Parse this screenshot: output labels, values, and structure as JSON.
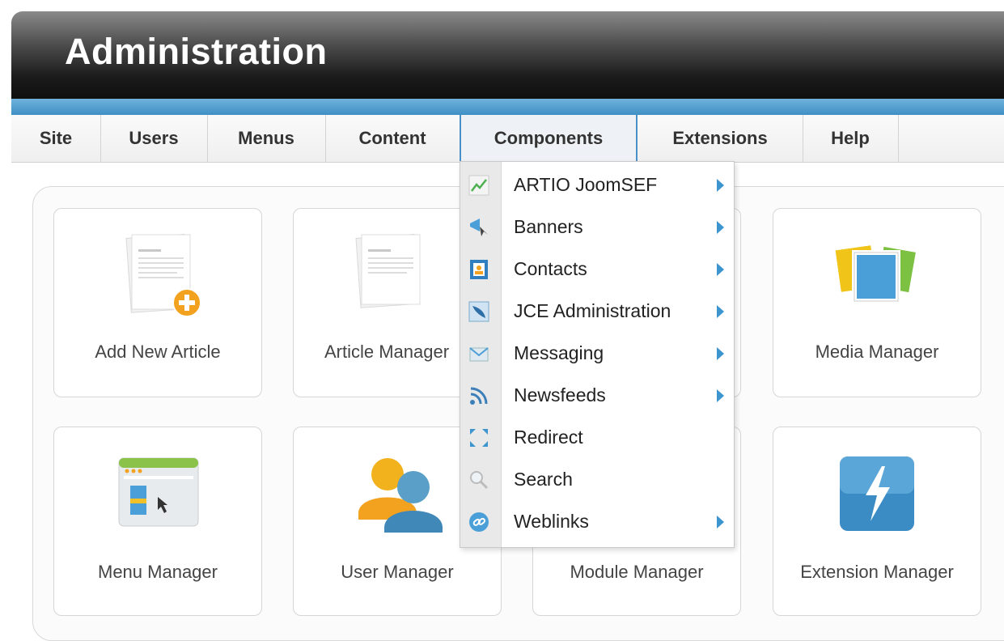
{
  "header": {
    "title": "Administration"
  },
  "menu": [
    {
      "label": "Site"
    },
    {
      "label": "Users"
    },
    {
      "label": "Menus"
    },
    {
      "label": "Content"
    },
    {
      "label": "Components"
    },
    {
      "label": "Extensions"
    },
    {
      "label": "Help"
    }
  ],
  "dropdown": [
    {
      "label": "ARTIO JoomSEF",
      "icon": "chart-icon",
      "submenu": true
    },
    {
      "label": "Banners",
      "icon": "banner-icon",
      "submenu": true
    },
    {
      "label": "Contacts",
      "icon": "contacts-icon",
      "submenu": true
    },
    {
      "label": "JCE Administration",
      "icon": "quill-icon",
      "submenu": true
    },
    {
      "label": "Messaging",
      "icon": "envelope-icon",
      "submenu": true
    },
    {
      "label": "Newsfeeds",
      "icon": "rss-icon",
      "submenu": true
    },
    {
      "label": "Redirect",
      "icon": "redirect-icon",
      "submenu": false
    },
    {
      "label": "Search",
      "icon": "magnifier-icon",
      "submenu": false
    },
    {
      "label": "Weblinks",
      "icon": "link-icon",
      "submenu": true
    }
  ],
  "tiles": [
    {
      "label": "Add New Article",
      "icon": "add-article-icon"
    },
    {
      "label": "Article Manager",
      "icon": "article-icon"
    },
    {
      "label": "Media Manager",
      "icon": "media-icon"
    },
    {
      "label": "Menu Manager",
      "icon": "menu-manager-icon"
    },
    {
      "label": "User Manager",
      "icon": "users-icon"
    },
    {
      "label": "Module Manager",
      "icon": "module-icon"
    },
    {
      "label": "Extension Manager",
      "icon": "extension-icon"
    }
  ],
  "colors": {
    "accent": "#3d95d0",
    "header_dark": "#1b1b1b"
  }
}
